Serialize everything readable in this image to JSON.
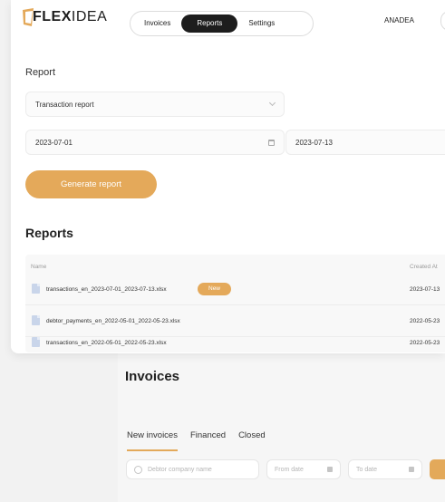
{
  "app": {
    "logo_bold": "FLEX",
    "logo_light": "IDEA"
  },
  "nav": {
    "items": [
      "Invoices",
      "Reports",
      "Settings"
    ],
    "active": "Reports"
  },
  "user": {
    "name": "ANADEA"
  },
  "report_form": {
    "section_label": "Report",
    "report_type": "Transaction report",
    "date_from": "2023-07-01",
    "date_to": "2023-07-13",
    "generate_label": "Generate report"
  },
  "reports": {
    "title": "Reports",
    "columns": {
      "name": "Name",
      "created": "Created At"
    },
    "rows": [
      {
        "name": "transactions_en_2023-07-01_2023-07-13.xlsx",
        "badge": "New",
        "created": "2023-07-13"
      },
      {
        "name": "debtor_payments_en_2022-05-01_2022-05-23.xlsx",
        "badge": "",
        "created": "2022-05-23"
      },
      {
        "name": "transactions_en_2022-05-01_2022-05-23.xlsx",
        "badge": "",
        "created": "2022-05-23"
      }
    ]
  },
  "background_page": {
    "title": "Invoices",
    "tabs": [
      "New invoices",
      "Financed",
      "Closed"
    ],
    "search_placeholder": "Debtor company name",
    "from_placeholder": "From date",
    "to_placeholder": "To date"
  },
  "colors": {
    "accent": "#e4a95a",
    "dark": "#1d1d1d",
    "file_icon": "#c9d5ea"
  }
}
